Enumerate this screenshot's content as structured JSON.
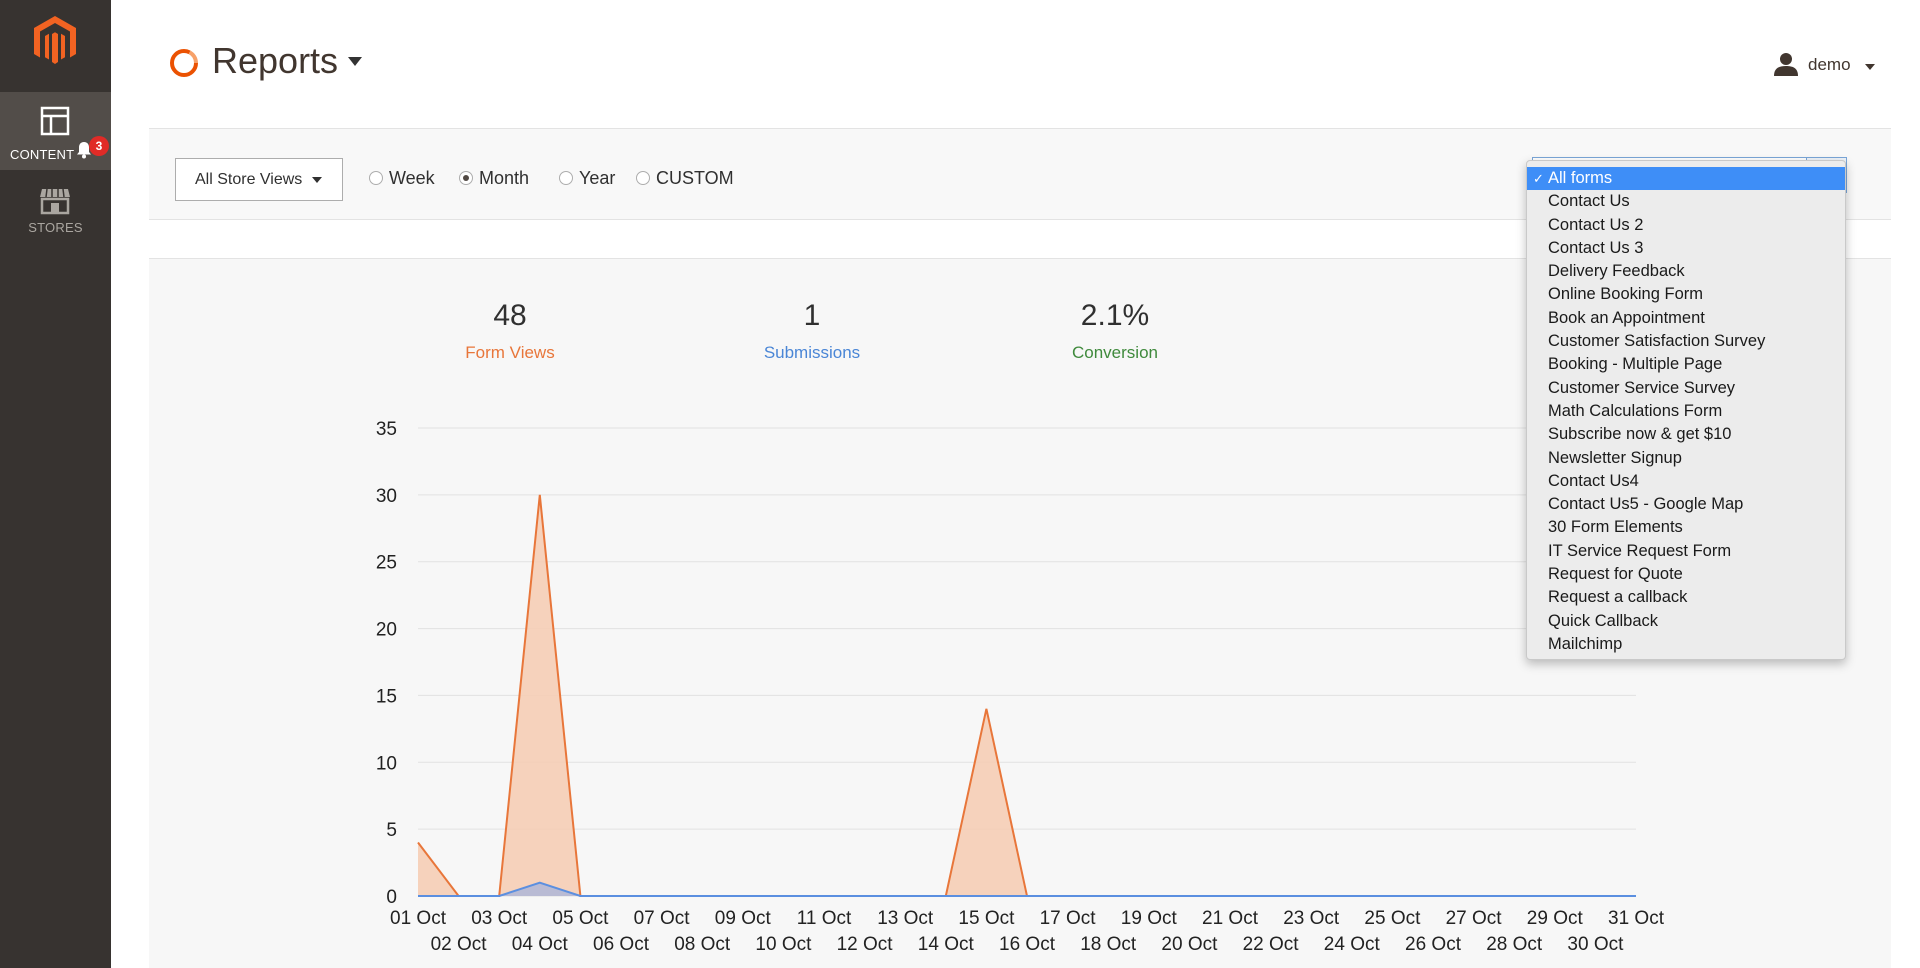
{
  "app": {
    "title": "Reports",
    "sidebar": {
      "items": [
        {
          "label": "CONTENT",
          "icon": "layout-icon",
          "active": true,
          "notification_count": "3"
        },
        {
          "label": "STORES",
          "icon": "store-icon",
          "active": false
        }
      ]
    },
    "header": {
      "user_name": "demo"
    },
    "filters": {
      "store_view": "All Store Views",
      "periods": [
        {
          "label": "Week",
          "checked": false
        },
        {
          "label": "Month",
          "checked": true
        },
        {
          "label": "Year",
          "checked": false
        },
        {
          "label": "CUSTOM",
          "checked": false
        }
      ],
      "form_options": [
        "All forms",
        "Contact Us",
        "Contact Us 2",
        "Contact Us 3",
        "Delivery Feedback",
        "Online Booking Form",
        "Book an Appointment",
        "Customer Satisfaction Survey",
        "Booking - Multiple Page",
        "Customer Service Survey",
        "Math Calculations Form",
        "Subscribe now & get $10",
        "Newsletter Signup",
        "Contact Us4",
        "Contact Us5 - Google Map",
        "30 Form Elements",
        "IT Service Request Form",
        "Request for Quote",
        "Request a callback",
        "Quick Callback",
        "Mailchimp"
      ],
      "selected_form": "All forms",
      "check_mark": "✓"
    },
    "stats": [
      {
        "value": "48",
        "label": "Form Views",
        "color": "#e8763a"
      },
      {
        "value": "1",
        "label": "Submissions",
        "color": "#4a86d6"
      },
      {
        "value": "2.1%",
        "label": "Conversion",
        "color": "#3f8a3c"
      }
    ]
  },
  "chart_data": {
    "type": "area",
    "x": [
      "01 Oct",
      "02 Oct",
      "03 Oct",
      "04 Oct",
      "05 Oct",
      "06 Oct",
      "07 Oct",
      "08 Oct",
      "09 Oct",
      "10 Oct",
      "11 Oct",
      "12 Oct",
      "13 Oct",
      "14 Oct",
      "15 Oct",
      "16 Oct",
      "17 Oct",
      "18 Oct",
      "19 Oct",
      "20 Oct",
      "21 Oct",
      "22 Oct",
      "23 Oct",
      "24 Oct",
      "25 Oct",
      "26 Oct",
      "27 Oct",
      "28 Oct",
      "29 Oct",
      "30 Oct",
      "31 Oct"
    ],
    "series": [
      {
        "name": "Form Views",
        "color": "#e8763a",
        "fill": "#f5cdb5",
        "values": [
          4,
          0,
          0,
          30,
          0,
          0,
          0,
          0,
          0,
          0,
          0,
          0,
          0,
          0,
          14,
          0,
          0,
          0,
          0,
          0,
          0,
          0,
          0,
          0,
          0,
          0,
          0,
          0,
          0,
          0,
          0
        ]
      },
      {
        "name": "Submissions",
        "color": "#5b8fe0",
        "fill": "#aeb7d8",
        "values": [
          0,
          0,
          0,
          1,
          0,
          0,
          0,
          0,
          0,
          0,
          0,
          0,
          0,
          0,
          0,
          0,
          0,
          0,
          0,
          0,
          0,
          0,
          0,
          0,
          0,
          0,
          0,
          0,
          0,
          0,
          0
        ]
      }
    ],
    "ylim": [
      0,
      35
    ],
    "yticks": [
      0,
      5,
      10,
      15,
      20,
      25,
      30,
      35
    ],
    "grid": true
  }
}
